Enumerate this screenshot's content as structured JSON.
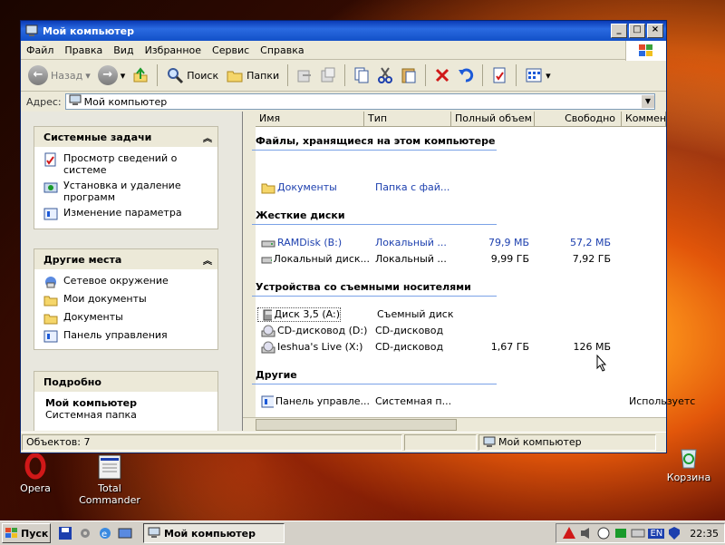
{
  "window": {
    "title": "Мой компьютер",
    "menu": [
      "Файл",
      "Правка",
      "Вид",
      "Избранное",
      "Сервис",
      "Справка"
    ],
    "toolbar": {
      "back": "Назад",
      "search": "Поиск",
      "folders": "Папки"
    },
    "address_label": "Адрес:",
    "address_value": "Мой компьютер"
  },
  "tasks": {
    "system": {
      "title": "Системные задачи",
      "items": [
        "Просмотр сведений о системе",
        "Установка и удаление программ",
        "Изменение параметра"
      ]
    },
    "places": {
      "title": "Другие места",
      "items": [
        "Сетевое окружение",
        "Мои документы",
        "Документы",
        "Панель управления"
      ]
    },
    "details": {
      "title": "Подробно",
      "name": "Мой компьютер",
      "type": "Системная папка"
    }
  },
  "columns": [
    "Имя",
    "Тип",
    "Полный объем",
    "Свободно",
    "Комментарии"
  ],
  "groups": [
    {
      "title": "Файлы, хранящиеся на этом компьютере",
      "rows": [
        {
          "name": "Документы",
          "type": "Папка с фай...",
          "total": "",
          "free": "",
          "comment": ""
        }
      ]
    },
    {
      "title": "Жесткие диски",
      "rows": [
        {
          "name": "RAMDisk (B:)",
          "type": "Локальный ...",
          "total": "79,9 МБ",
          "free": "57,2 МБ",
          "comment": ""
        },
        {
          "name": "Локальный диск...",
          "type": "Локальный ...",
          "total": "9,99 ГБ",
          "free": "7,92 ГБ",
          "comment": ""
        }
      ]
    },
    {
      "title": "Устройства со съемными носителями",
      "rows": [
        {
          "name": "Диск 3,5 (A:)",
          "type": "Съемный диск",
          "total": "",
          "free": "",
          "comment": ""
        },
        {
          "name": "CD-дисковод (D:)",
          "type": "CD-дисковод",
          "total": "",
          "free": "",
          "comment": ""
        },
        {
          "name": "Ieshua's Live (X:)",
          "type": "CD-дисковод",
          "total": "1,67 ГБ",
          "free": "126 МБ",
          "comment": ""
        }
      ]
    },
    {
      "title": "Другие",
      "rows": [
        {
          "name": "Панель управле...",
          "type": "Системная п...",
          "total": "",
          "free": "",
          "comment": "Используетс"
        }
      ]
    }
  ],
  "status": {
    "objects": "Объектов: 7",
    "location": "Мой компьютер"
  },
  "desktop": {
    "opera": "Opera",
    "total_commander": "Total Commander",
    "recycle": "Корзина"
  },
  "taskbar": {
    "start": "Пуск",
    "task": "Мой компьютер",
    "lang": "EN",
    "clock": "22:35"
  },
  "colors": {
    "title_bar": "#0a3ab4",
    "link_blue": "#1c3fae",
    "pane_bg": "#ece9d8"
  }
}
